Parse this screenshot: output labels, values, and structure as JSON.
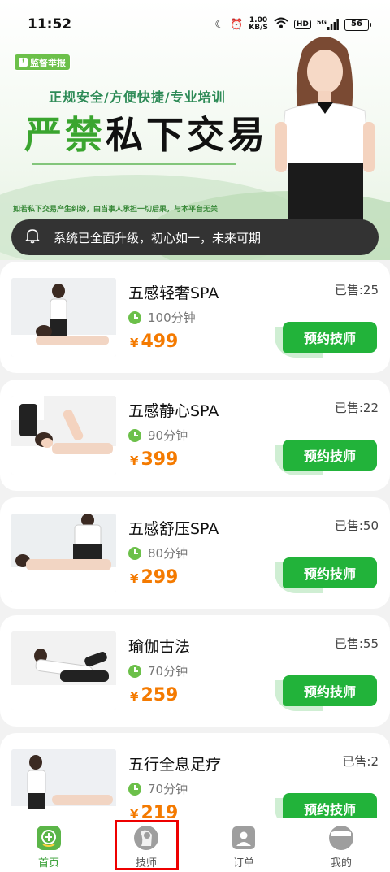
{
  "status_bar": {
    "time": "11:52",
    "net_speed_value": "1.00",
    "net_speed_unit": "KB/S",
    "hd": "HD",
    "signal": "5G",
    "battery": "56"
  },
  "banner": {
    "report_badge": "监督举报",
    "subtitle": "正规安全/方便快捷/专业培训",
    "title_green": "严禁",
    "title_black": "私下交易",
    "note": "如若私下交易产生纠纷，由当事人承担一切后果，与本平台无关"
  },
  "notice": {
    "text": "系统已全面升级，初心如一，未来可期"
  },
  "services": [
    {
      "name": "五感轻奢SPA",
      "sold": "已售:25",
      "duration": "100分钟",
      "currency": "¥",
      "price": "499",
      "button": "预约技师"
    },
    {
      "name": "五感静心SPA",
      "sold": "已售:22",
      "duration": "90分钟",
      "currency": "¥",
      "price": "399",
      "button": "预约技师"
    },
    {
      "name": "五感舒压SPA",
      "sold": "已售:50",
      "duration": "80分钟",
      "currency": "¥",
      "price": "299",
      "button": "预约技师"
    },
    {
      "name": "瑜伽古法",
      "sold": "已售:55",
      "duration": "70分钟",
      "currency": "¥",
      "price": "259",
      "button": "预约技师"
    },
    {
      "name": "五行全息足疗",
      "sold": "已售:2",
      "duration": "70分钟",
      "currency": "¥",
      "price": "219",
      "button": "预约技师"
    }
  ],
  "tabbar": {
    "home": "首页",
    "technician": "技师",
    "orders": "订单",
    "mine": "我的",
    "active_color": "#2c9a2a",
    "highlight_color": "#e00000"
  }
}
